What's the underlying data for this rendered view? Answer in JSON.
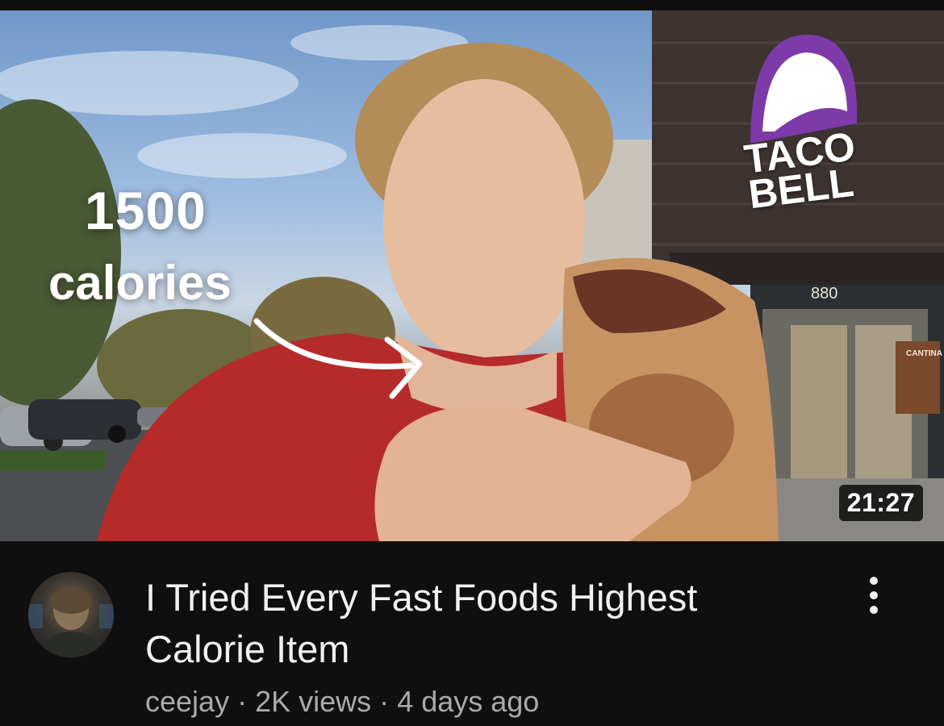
{
  "thumbnail": {
    "overlay_number": "1500",
    "overlay_word": "calories",
    "logo_line1": "TACO",
    "logo_line2": "BELL",
    "store_number": "880",
    "cantina_label": "CANTINA",
    "duration": "21:27"
  },
  "video": {
    "title": "I Tried Every Fast Foods Highest Calorie Item",
    "channel": "ceejay",
    "separator": "·",
    "views": "2K views",
    "age": "4 days ago"
  },
  "colors": {
    "background": "#0f0f0f",
    "title_text": "#f1f1f1",
    "meta_text": "#aaaaaa",
    "logo_purple": "#7d3aa8",
    "shirt_red": "#b42b2a"
  },
  "icons": {
    "more": "more-vertical-icon"
  }
}
